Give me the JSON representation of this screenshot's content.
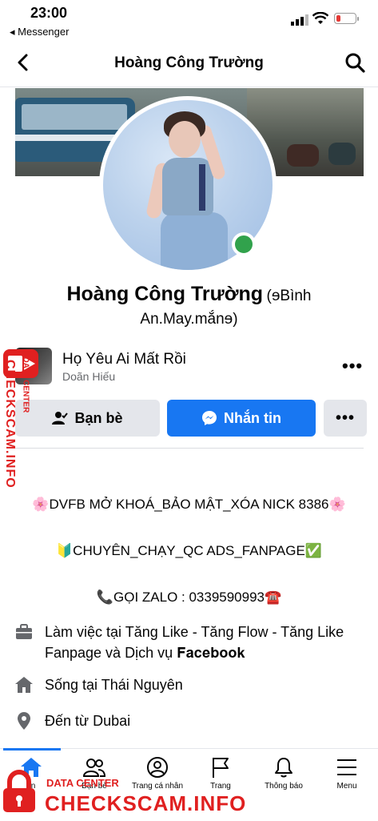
{
  "status_bar": {
    "time": "23:00",
    "back_app": "◂ Messenger"
  },
  "header": {
    "title": "Hoàng Công Trường"
  },
  "profile": {
    "name": "Hoàng Công Trường",
    "alt_name_part1": "(ɘBình",
    "alt_name_part2": "An.May.mắnɘ)",
    "online": true
  },
  "music": {
    "title": "Họ Yêu Ai Mất Rồi",
    "artist": "Doãn Hiếu"
  },
  "actions": {
    "friends_label": "Bạn bè",
    "message_label": "Nhắn tin",
    "more_label": "•••"
  },
  "bio": {
    "line1": "🌸DVFB MỞ KHOÁ_BẢO MẬT_XÓA NICK 8386🌸",
    "line2": "🔰CHUYÊN_CHẠY_QC ADS_FANPAGE✅",
    "line3": "📞GỌI ZALO : 0339590993☎️"
  },
  "details": {
    "work_prefix": "Làm việc tại ",
    "work_place": "Tăng Like - Tăng Flow - Tăng Like Fanpage và Dịch vụ 𝐅𝐚𝐜𝐞𝐛𝐨𝐨𝐤",
    "lives_prefix": "Sống tại ",
    "lives_place": "Thái Nguyên",
    "from_prefix": "Đến từ ",
    "from_place": "Dubai"
  },
  "tabs": [
    {
      "label": "tin",
      "icon": "home-icon",
      "active": true
    },
    {
      "label": "Bạn bè",
      "icon": "friends-icon",
      "active": false
    },
    {
      "label": "Trang cá nhân",
      "icon": "profile-icon",
      "active": false
    },
    {
      "label": "Trang",
      "icon": "flag-icon",
      "active": false
    },
    {
      "label": "Thông báo",
      "icon": "bell-icon",
      "active": false
    },
    {
      "label": "Menu",
      "icon": "menu-icon",
      "active": false
    }
  ],
  "watermark": {
    "side_text": "CHECKSCAM.INFO",
    "side_sub": "DATA CENTER",
    "bottom_sub": "DATA CENTER",
    "bottom_text": "CHECKSCAM.INFO"
  },
  "colors": {
    "accent": "#1877f2",
    "online": "#31a24c",
    "watermark": "#e02020"
  }
}
